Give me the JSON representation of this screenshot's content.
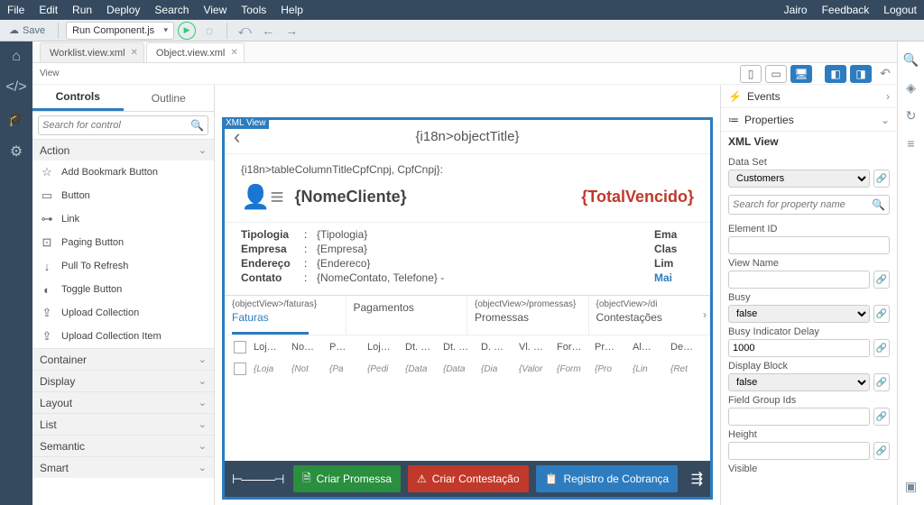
{
  "menu": {
    "left": [
      "File",
      "Edit",
      "Run",
      "Deploy",
      "Search",
      "View",
      "Tools",
      "Help"
    ],
    "right": [
      "Jairo",
      "Feedback",
      "Logout"
    ]
  },
  "toolbar": {
    "save_label": "Save",
    "run_config": "Run Component.js"
  },
  "filetabs": [
    {
      "name": "Worklist.view.xml"
    },
    {
      "name": "Object.view.xml"
    }
  ],
  "view_label": "View",
  "left_panel": {
    "tabs": {
      "controls": "Controls",
      "outline": "Outline"
    },
    "search_placeholder": "Search for control",
    "sections": {
      "action": "Action",
      "container": "Container",
      "display": "Display",
      "layout": "Layout",
      "list": "List",
      "semantic": "Semantic",
      "smart": "Smart"
    },
    "action_items": [
      "Add Bookmark Button",
      "Button",
      "Link",
      "Paging Button",
      "Pull To Refresh",
      "Toggle Button",
      "Upload Collection",
      "Upload Collection Item"
    ]
  },
  "canvas": {
    "xml_badge": "XML View",
    "title": "{i18n>objectTitle}",
    "subhead": "{i18n>tableColumnTitleCpfCnpj, CpfCnpj}:",
    "customer_name": "{NomeCliente}",
    "total": "{TotalVencido}",
    "details_left": [
      {
        "label": "Tipologia",
        "value": "{Tipologia}"
      },
      {
        "label": "Empresa",
        "value": "{Empresa}"
      },
      {
        "label": "Endereço",
        "value": "{Endereco}"
      },
      {
        "label": "Contato",
        "value": "{NomeContato, Telefone} -"
      }
    ],
    "details_right": [
      "Ema",
      "Clas",
      "Lim"
    ],
    "details_more": "Mai",
    "tabs": [
      {
        "path": "{objectView>/faturas}",
        "label": "Faturas",
        "active": true
      },
      {
        "path": "",
        "label": "Pagamentos",
        "active": false,
        "plain": true
      },
      {
        "path": "{objectView>/promessas}",
        "label": "Promessas",
        "active": false
      },
      {
        "path": "{objectView>/di",
        "label": "Contestações",
        "active": false
      }
    ],
    "columns": [
      "Loj…",
      "No…",
      "P…",
      "Loj…",
      "Dt. …",
      "Dt. …",
      "D. …",
      "Vl. …",
      "For…",
      "Pr…",
      "Al…",
      "De…"
    ],
    "row_placeholders": [
      "{Loja",
      "{Not",
      "{Pa",
      "{Pedi",
      "{Data",
      "{Data",
      "{Dia",
      "{Valor",
      "{Form",
      "{Pro",
      "{Lin",
      "{Ret"
    ],
    "footer": {
      "promessa": "Criar Promessa",
      "contest": "Criar Contestação",
      "registro": "Registro de Cobrança"
    }
  },
  "properties": {
    "events_header": "Events",
    "props_header": "Properties",
    "subtitle": "XML View",
    "dataset_label": "Data Set",
    "dataset_value": "Customers",
    "search_placeholder": "Search for property name",
    "fields": {
      "element_id": {
        "label": "Element ID",
        "value": ""
      },
      "view_name": {
        "label": "View Name",
        "value": ""
      },
      "busy": {
        "label": "Busy",
        "value": "false"
      },
      "busy_delay": {
        "label": "Busy Indicator Delay",
        "value": "1000"
      },
      "display_block": {
        "label": "Display Block",
        "value": "false"
      },
      "field_group": {
        "label": "Field Group Ids",
        "value": ""
      },
      "height": {
        "label": "Height",
        "value": ""
      },
      "visible": {
        "label": "Visible",
        "value": ""
      }
    }
  }
}
